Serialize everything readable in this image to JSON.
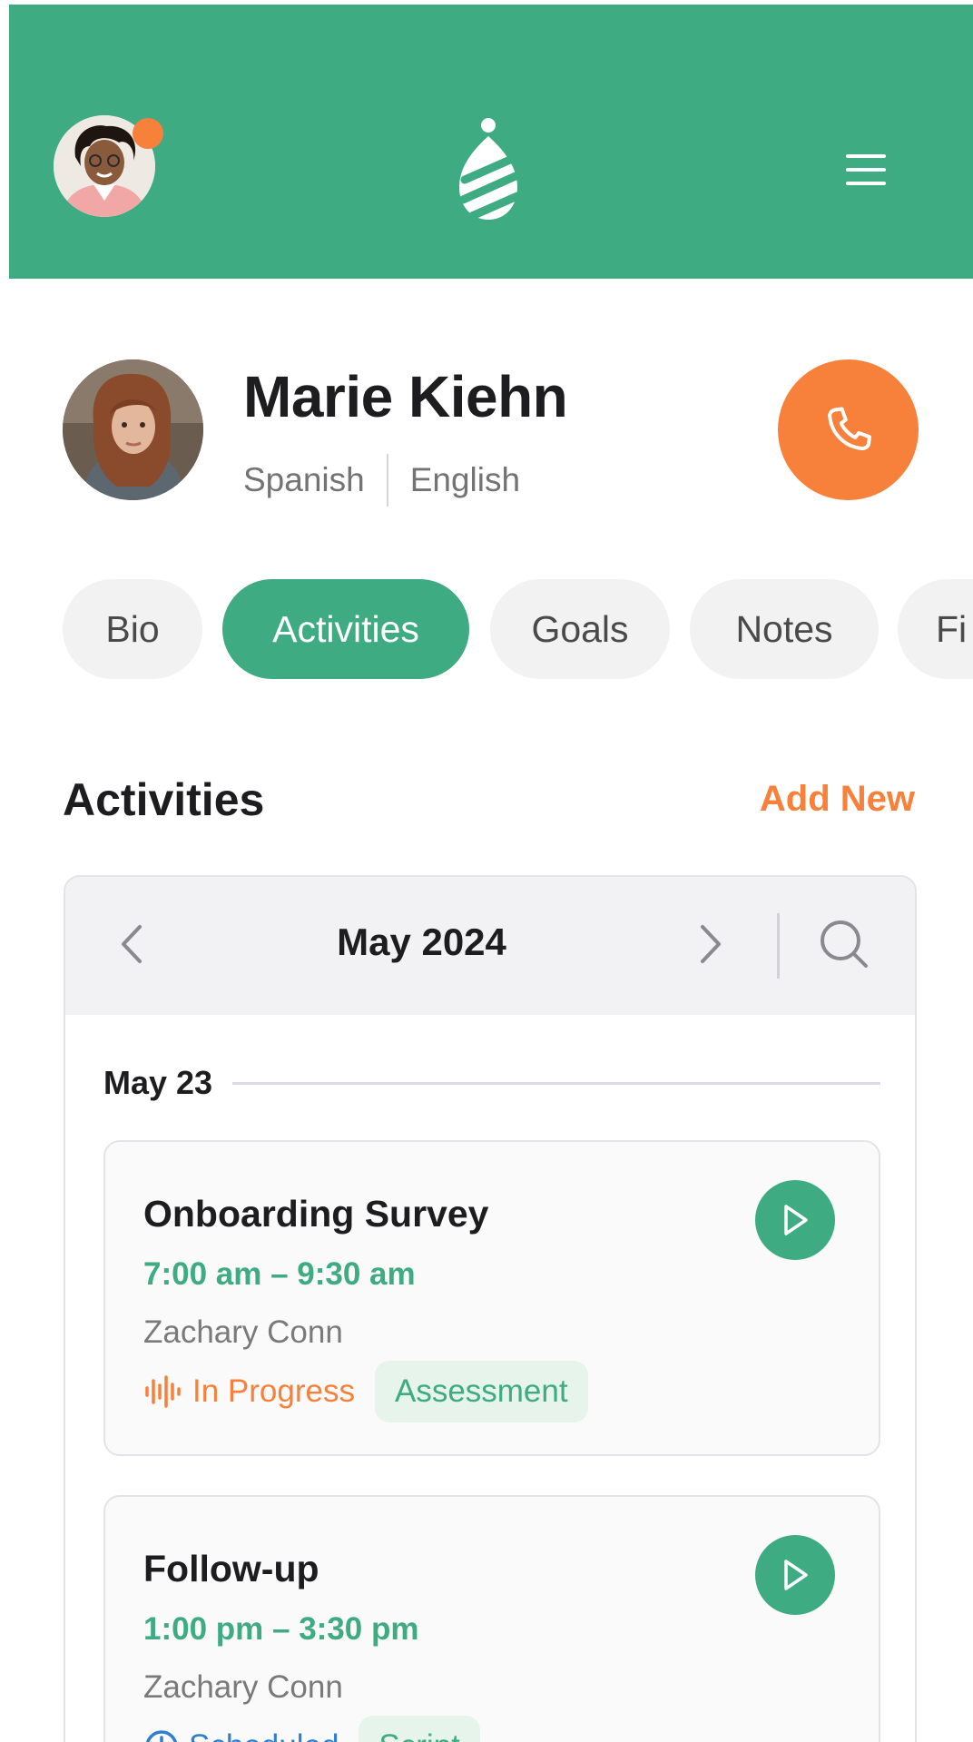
{
  "header": {
    "avatar_icon": "user-avatar",
    "notification_dot_color": "#f7803a",
    "logo_icon": "brand-logo-icon",
    "menu_icon": "hamburger-menu-icon",
    "brand_color": "#3eab82"
  },
  "profile": {
    "name": "Marie Kiehn",
    "languages": [
      "Spanish",
      "English"
    ],
    "call_icon": "phone-icon",
    "accent_color": "#f7803a"
  },
  "tabs": [
    {
      "label": "Bio",
      "active": false
    },
    {
      "label": "Activities",
      "active": true
    },
    {
      "label": "Goals",
      "active": false
    },
    {
      "label": "Notes",
      "active": false
    },
    {
      "label": "Fi",
      "active": false
    }
  ],
  "activities": {
    "title": "Activities",
    "add_new_label": "Add New",
    "calendar": {
      "month_label": "May 2024",
      "prev_icon": "chevron-left-icon",
      "next_icon": "chevron-right-icon",
      "search_icon": "search-icon"
    },
    "date_groups": [
      {
        "date_label": "May 23",
        "items": [
          {
            "title": "Onboarding Survey",
            "time": "7:00 am – 9:30 am",
            "person": "Zachary Conn",
            "status": "In Progress",
            "status_icon": "audio-wave-icon",
            "tag": "Assessment",
            "play_icon": "play-icon"
          },
          {
            "title": "Follow-up",
            "time": "1:00 pm – 3:30 pm",
            "person": "Zachary Conn",
            "status": "Scheduled",
            "status_icon": "clock-icon",
            "tag": "Script",
            "play_icon": "play-icon"
          }
        ]
      }
    ]
  }
}
